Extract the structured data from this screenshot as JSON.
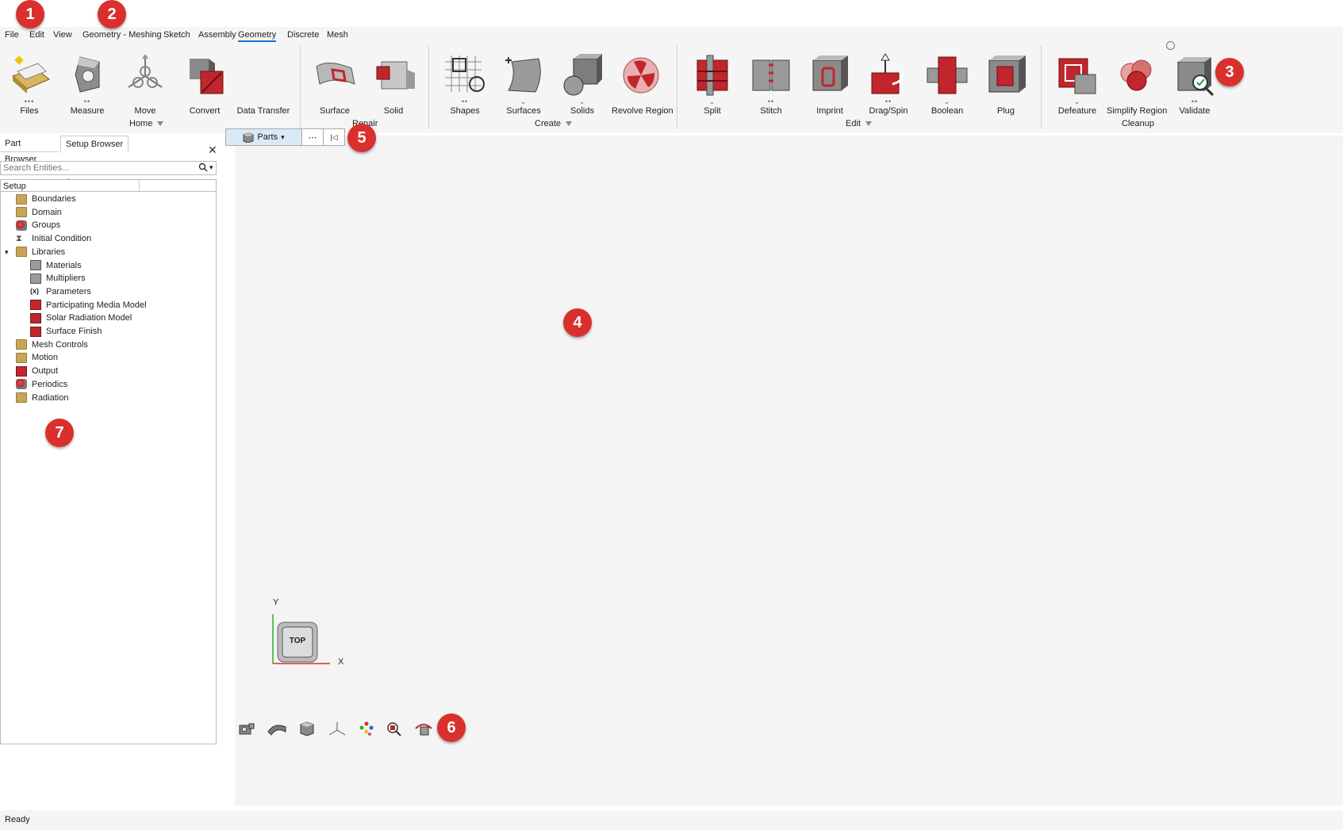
{
  "menu": [
    "File",
    "Edit",
    "View",
    "Geometry - Meshing",
    "Sketch",
    "Assembly",
    "Geometry",
    "Discrete",
    "Mesh"
  ],
  "menu_active": "Geometry",
  "ribbon": {
    "tools": [
      "Files",
      "Measure",
      "Move",
      "Convert",
      "Data Transfer",
      "Surface",
      "Solid",
      "Shapes",
      "Surfaces",
      "Solids",
      "Revolve Region",
      "Split",
      "Stitch",
      "Imprint",
      "Drag/Spin",
      "Boolean",
      "Plug",
      "Defeature",
      "Simplify Region",
      "Validate"
    ],
    "groups": {
      "home": "Home",
      "repair": "Repair",
      "create": "Create",
      "edit": "Edit",
      "cleanup": "Cleanup"
    }
  },
  "panel": {
    "tabs": [
      "Part Browser",
      "Setup Browser"
    ],
    "active_tab": "Setup Browser",
    "search_placeholder": "Search Entities...",
    "column_header": "Setup",
    "tree": [
      {
        "label": "Boundaries",
        "level": 0,
        "icon": "folder-icon"
      },
      {
        "label": "Domain",
        "level": 0,
        "icon": "folder-icon"
      },
      {
        "label": "Groups",
        "level": 0,
        "icon": "groups-icon"
      },
      {
        "label": "Initial Condition",
        "level": 0,
        "icon": "hourglass-icon"
      },
      {
        "label": "Libraries",
        "level": 0,
        "icon": "folder-icon",
        "expanded": true
      },
      {
        "label": "Materials",
        "level": 1,
        "icon": "materials-icon"
      },
      {
        "label": "Multipliers",
        "level": 1,
        "icon": "multipliers-icon"
      },
      {
        "label": "Parameters",
        "level": 1,
        "icon": "parameters-icon"
      },
      {
        "label": "Participating Media Model",
        "level": 1,
        "icon": "model-icon"
      },
      {
        "label": "Solar Radiation Model",
        "level": 1,
        "icon": "model-icon"
      },
      {
        "label": "Surface Finish",
        "level": 1,
        "icon": "model-icon"
      },
      {
        "label": "Mesh Controls",
        "level": 0,
        "icon": "folder-icon"
      },
      {
        "label": "Motion",
        "level": 0,
        "icon": "folder-icon"
      },
      {
        "label": "Output",
        "level": 0,
        "icon": "output-icon"
      },
      {
        "label": "Periodics",
        "level": 0,
        "icon": "periodics-icon"
      },
      {
        "label": "Radiation",
        "level": 0,
        "icon": "folder-icon"
      }
    ]
  },
  "viewport_toolbar": {
    "parts_label": "Parts",
    "more_label": "⋯",
    "first_label": "|◁"
  },
  "view_cube": {
    "face_label": "TOP",
    "y_axis": "Y",
    "x_axis": "X"
  },
  "bottom_tools": [
    "camera-icon",
    "surface-icon",
    "cube-icon",
    "axes-icon",
    "color-icon",
    "zoom-fit-icon",
    "view-3d-icon"
  ],
  "callouts": [
    "1",
    "2",
    "3",
    "4",
    "5",
    "6",
    "7"
  ],
  "status": "Ready",
  "colors": {
    "accent": "#1a73c9",
    "callout": "#d9302d",
    "ribbon_bg": "#f5f5f5",
    "viewport_bg": "#f4f4f4",
    "icon_red": "#c0262c"
  }
}
